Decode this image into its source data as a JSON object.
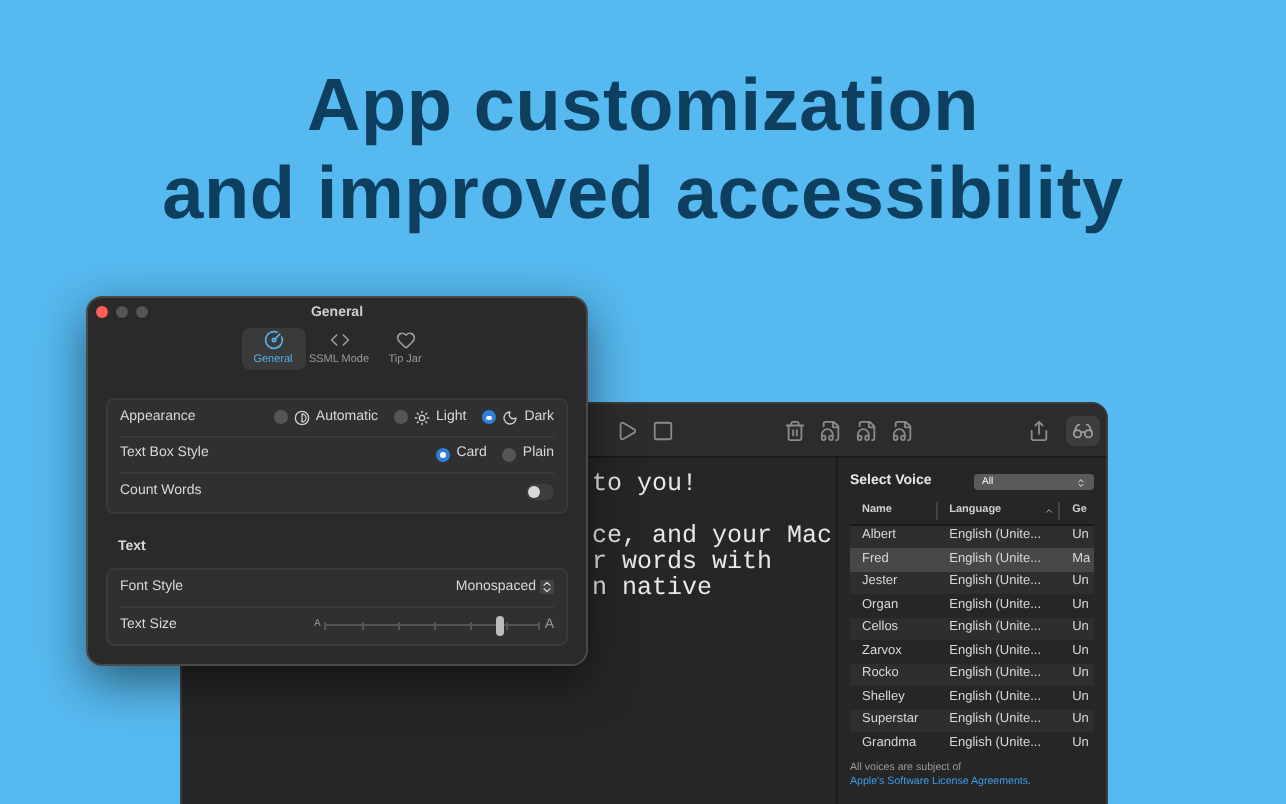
{
  "headline": [
    "App customization",
    "and improved accessibility"
  ],
  "main_window": {
    "editor": {
      "paragraphs": [
        [
          "to you!"
        ],
        [
          "ce, and your Mac",
          "r words with",
          "n native"
        ]
      ]
    },
    "voice_panel": {
      "title": "Select Voice",
      "filter": "All",
      "columns": [
        {
          "label": "Name",
          "sorted": false
        },
        {
          "label": "Language",
          "sorted": true
        },
        {
          "label": "Ge",
          "sorted": false
        }
      ],
      "rows": [
        {
          "cells": [
            "Albert",
            "English (Unite...",
            "Un"
          ],
          "selected": false
        },
        {
          "cells": [
            "Fred",
            "English (Unite...",
            "Ma"
          ],
          "selected": true
        },
        {
          "cells": [
            "Jester",
            "English (Unite...",
            "Un"
          ],
          "selected": false
        },
        {
          "cells": [
            "Organ",
            "English (Unite...",
            "Un"
          ],
          "selected": false
        },
        {
          "cells": [
            "Cellos",
            "English (Unite...",
            "Un"
          ],
          "selected": false
        },
        {
          "cells": [
            "Zarvox",
            "English (Unite...",
            "Un"
          ],
          "selected": false
        },
        {
          "cells": [
            "Rocko",
            "English (Unite...",
            "Un"
          ],
          "selected": false
        },
        {
          "cells": [
            "Shelley",
            "English (Unite...",
            "Un"
          ],
          "selected": false
        },
        {
          "cells": [
            "Superstar",
            "English (Unite...",
            "Un"
          ],
          "selected": false
        },
        {
          "cells": [
            "Grandma",
            "English (Unite...",
            "Un"
          ],
          "selected": false
        }
      ],
      "footnote": {
        "text": "All voices are subject of",
        "link": "Apple's Software License Agreements."
      }
    }
  },
  "settings_window": {
    "title": "General",
    "tabs": [
      {
        "label": "General",
        "selected": true
      },
      {
        "label": "SSML Mode",
        "selected": false
      },
      {
        "label": "Tip Jar",
        "selected": false
      }
    ],
    "general_rows": [
      {
        "kind": "appearance",
        "label": "Appearance",
        "options": [
          {
            "label": "Automatic",
            "selected": false
          },
          {
            "label": "Light",
            "selected": false
          },
          {
            "label": "Dark",
            "selected": true
          }
        ]
      },
      {
        "kind": "radio",
        "label": "Text Box Style",
        "options": [
          {
            "label": "Card",
            "selected": true
          },
          {
            "label": "Plain",
            "selected": false
          }
        ]
      },
      {
        "kind": "toggle",
        "label": "Count Words",
        "on": false
      }
    ],
    "text_section": {
      "title": "Text",
      "rows": [
        {
          "kind": "popup",
          "label": "Font Style",
          "value": "Monospaced"
        },
        {
          "kind": "slider",
          "label": "Text Size",
          "small_label": "A",
          "large_label": "A",
          "level": 0.82
        }
      ]
    }
  }
}
